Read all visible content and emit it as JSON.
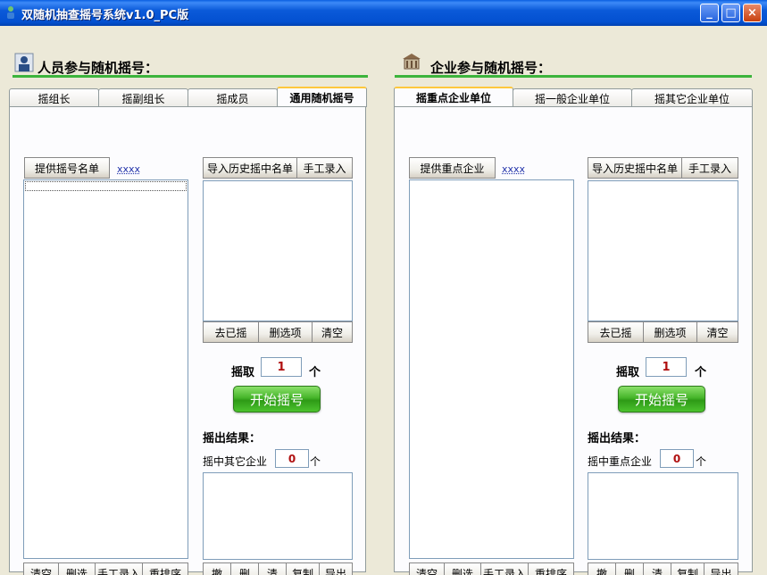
{
  "window": {
    "title": "双随机抽查摇号系统v1.0_PC版",
    "buttons": {
      "minimize": "_",
      "maximize": "□",
      "close": "×"
    }
  },
  "personnel": {
    "section_title": "人员参与随机摇号：",
    "tabs": [
      "摇组长",
      "摇副组长",
      "摇成员",
      "通用随机摇号"
    ],
    "provide_list_button": "提供摇号名单",
    "provide_list_value": "xxxx",
    "import_history_button": "导入历史摇中名单",
    "manual_entry_button": "手工录入",
    "remove_drawn_button": "去已摇",
    "delete_selected_button": "删选项",
    "clear_button": "清空",
    "draw_label": "摇取",
    "draw_count": "1",
    "draw_unit": "个",
    "start_button": "开始摇号",
    "result_label": "摇出结果：",
    "hit_label": "摇中其它企业",
    "hit_count": "0",
    "hit_unit": "个",
    "left_bottom_buttons": [
      "清空",
      "删选",
      "手工录入",
      "重排序"
    ],
    "right_bottom_buttons": [
      "撤",
      "删",
      "清",
      "复制",
      "导出"
    ]
  },
  "enterprise": {
    "section_title": "企业参与随机摇号：",
    "tabs": [
      "摇重点企业单位",
      "摇一般企业单位",
      "摇其它企业单位"
    ],
    "provide_list_button": "提供重点企业",
    "provide_list_value": "xxxx",
    "import_history_button": "导入历史摇中名单",
    "manual_entry_button": "手工录入",
    "remove_drawn_button": "去已摇",
    "delete_selected_button": "删选项",
    "clear_button": "清空",
    "draw_label": "摇取",
    "draw_count": "1",
    "draw_unit": "个",
    "start_button": "开始摇号",
    "result_label": "摇出结果：",
    "hit_label": "摇中重点企业",
    "hit_count": "0",
    "hit_unit": "个",
    "left_bottom_buttons": [
      "清空",
      "删选",
      "手工录入",
      "重排序"
    ],
    "right_bottom_buttons": [
      "撤",
      "删",
      "清",
      "复制",
      "导出"
    ]
  },
  "colors": {
    "title_bar": "#0350d0",
    "accent_green": "#3cb43c",
    "number_red": "#b01010",
    "link_blue": "#2233aa"
  }
}
